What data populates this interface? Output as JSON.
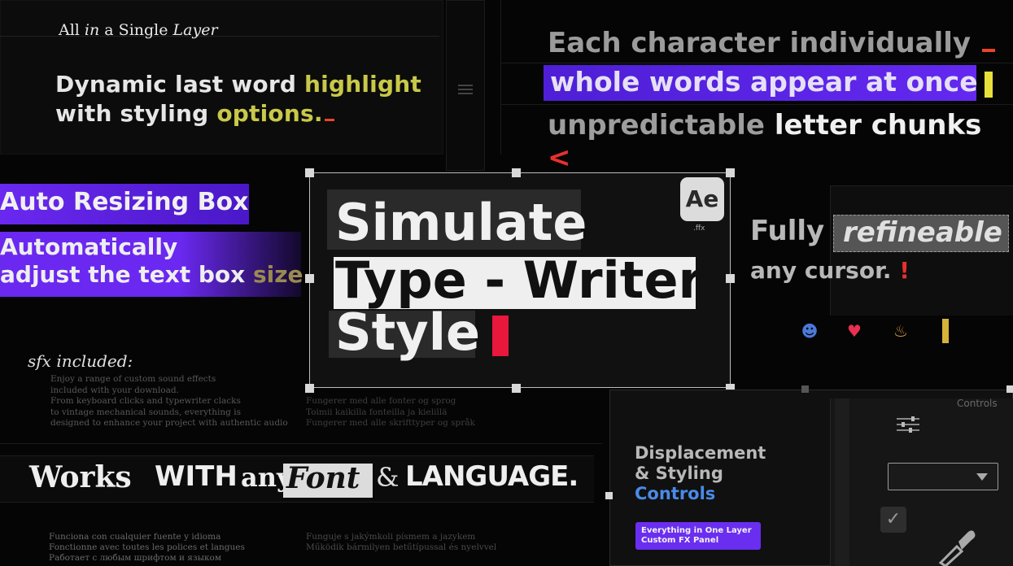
{
  "top_left": {
    "single_layer_all": "All",
    "single_layer_in": "in",
    "single_layer_mid": "a S",
    "single_layer_ingle": "ingle",
    "single_layer_layer": "Layer",
    "line1_a": "Dynamic last word",
    "line1_b": "highlight",
    "line2_a": "with styling",
    "line2_b": "options."
  },
  "top_right": {
    "each": "Each character individually",
    "whole": "whole words appear at once",
    "unpred_a": "unpredictable",
    "unpred_b": "letter chunks",
    "unpred_c": "<"
  },
  "left": {
    "auto_resizing": "Auto Resizing Box",
    "auto_line1": "Automatically",
    "auto_line2_a": "adjust the text box",
    "auto_line2_b": "size"
  },
  "center": {
    "line1": "Simulate",
    "line2": "Type - Writer",
    "line3": "Style",
    "badge": "Ae",
    "badge_sub": ".ffx"
  },
  "right_mid": {
    "fully": "Fully",
    "refineable": "refineable",
    "any_cursor": "any cursor.",
    "excl": "!",
    "emojis": [
      "☻",
      "♥",
      "♨"
    ]
  },
  "sfx": {
    "title_s": "s",
    "title_fx": "fx",
    "title_rest": "included:",
    "body": [
      "Enjoy a range of custom sound effects",
      "included with your download.",
      "From keyboard clicks and typewriter clacks",
      "to vintage mechanical sounds, everything is",
      "designed to enhance your project with authentic audio"
    ],
    "mid_body": [
      "Fungerer med alle fonter og sprog",
      "Toimii kaikilla fonteilla ja kielillä",
      "Fungerer med alle skrifttyper og språk"
    ]
  },
  "works": {
    "works": "Works",
    "with": "WITH",
    "any": "any",
    "font": "Font",
    "amp": "&",
    "language": "LANGUAGE."
  },
  "bottom_bodies": {
    "left": [
      "Funciona con cualquier fuente y idioma",
      "Fonctionne avec toutes les polices et langues",
      "Работает с любым шрифтом и языком"
    ],
    "mid": [
      "Funguje s jakýmkoli písmem a jazykem",
      "Működik bármilyen betűtípussal és nyelvvel"
    ]
  },
  "controls": {
    "label": "Controls",
    "disp1": "Displacement",
    "disp2": "& Styling",
    "disp3": "Controls",
    "everything1": "Everything in One Layer",
    "everything2": "Custom FX Panel",
    "check": "✓"
  },
  "colors": {
    "purple": "#6428f0",
    "yellow_highlight": "#c8c84a",
    "red_cursor": "#e8173c",
    "blue": "#4a8ae8"
  }
}
